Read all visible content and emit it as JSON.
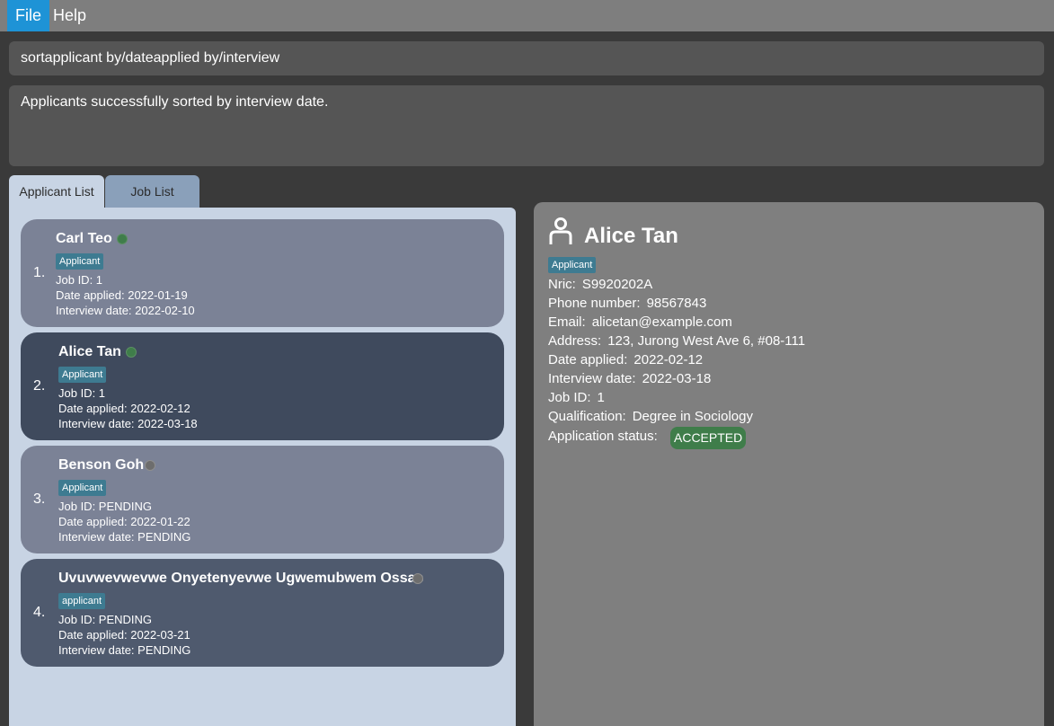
{
  "menu": {
    "file": "File",
    "help": "Help"
  },
  "command": {
    "value": "sortapplicant by/dateapplied by/interview"
  },
  "result": {
    "message": "Applicants successfully sorted by interview date."
  },
  "tabs": {
    "applicants": "Applicant List",
    "jobs": "Job List"
  },
  "applicants": [
    {
      "index": "1.",
      "name": "Carl Teo",
      "tag": "Applicant",
      "job_id": "Job ID: 1",
      "date_applied": "Date applied: 2022-01-19",
      "interview_date": "Interview date: 2022-02-10",
      "status_color": "#3f7d4a"
    },
    {
      "index": "2.",
      "name": "Alice Tan",
      "tag": "Applicant",
      "job_id": "Job ID: 1",
      "date_applied": "Date applied: 2022-02-12",
      "interview_date": "Interview date: 2022-03-18",
      "status_color": "#3f7d4a"
    },
    {
      "index": "3.",
      "name": "Benson Goh",
      "tag": "Applicant",
      "job_id": "Job ID: PENDING",
      "date_applied": "Date applied: 2022-01-22",
      "interview_date": "Interview date: PENDING",
      "status_color": "#6d6d6d"
    },
    {
      "index": "4.",
      "name": "Uvuvwevwevwe Onyetenyevwe Ugwemubwem Ossas",
      "tag": "applicant",
      "job_id": "Job ID: PENDING",
      "date_applied": "Date applied: 2022-03-21",
      "interview_date": "Interview date: PENDING",
      "status_color": "#6d6d6d"
    }
  ],
  "detail": {
    "icon": "person-icon",
    "name": "Alice Tan",
    "tag": "Applicant",
    "nric_label": "Nric:",
    "nric": "S9920202A",
    "phone_label": "Phone number:",
    "phone": "98567843",
    "email_label": "Email:",
    "email": "alicetan@example.com",
    "address_label": "Address:",
    "address": "123, Jurong West Ave 6, #08-111",
    "date_applied_label": "Date applied:",
    "date_applied": "2022-02-12",
    "interview_label": "Interview date:",
    "interview": "2022-03-18",
    "job_id_label": "Job ID:",
    "job_id": "1",
    "qualification_label": "Qualification:",
    "qualification": "Degree in Sociology",
    "status_label": "Application status:",
    "status": "ACCEPTED",
    "status_color": "#3f7d4a"
  },
  "colors": {
    "menu_active": "#1e93d6",
    "tag": "#3e7b91",
    "accepted": "#3f7d4a"
  }
}
